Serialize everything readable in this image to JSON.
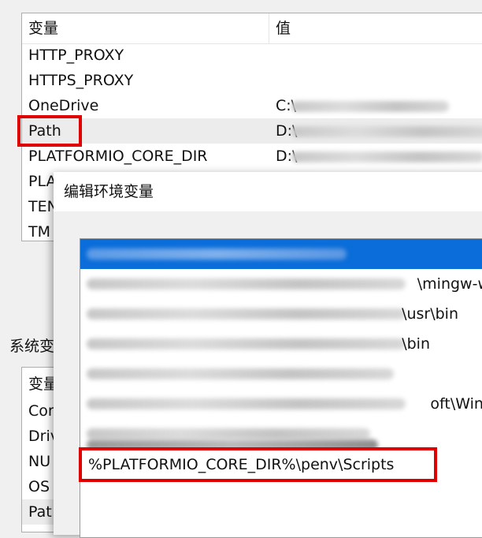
{
  "user_vars": {
    "header": {
      "name": "变量",
      "value": "值"
    },
    "rows": [
      {
        "name": "HTTP_PROXY",
        "value": ""
      },
      {
        "name": "HTTPS_PROXY",
        "value": ""
      },
      {
        "name": "OneDrive",
        "value": "C:\\"
      },
      {
        "name": "Path",
        "value": "D:\\"
      },
      {
        "name": "PLATFORMIO_CORE_DIR",
        "value": "D:\\"
      },
      {
        "name": "PLA",
        "value": ""
      },
      {
        "name": "TEN",
        "value": ""
      },
      {
        "name": "TM",
        "value": ""
      }
    ]
  },
  "system_vars": {
    "label": "系统变",
    "header": {
      "name": "变量"
    },
    "rows": [
      {
        "name": "Cor"
      },
      {
        "name": "Driv"
      },
      {
        "name": "NU"
      },
      {
        "name": "OS"
      },
      {
        "name": "Pat"
      }
    ]
  },
  "dialog": {
    "title": "编辑环境变量",
    "entries": [
      {
        "tail": ""
      },
      {
        "tail": "\\mingw-w"
      },
      {
        "tail": "\\usr\\bin"
      },
      {
        "tail": "\\bin"
      },
      {
        "tail": ""
      },
      {
        "tail": "oft\\Wind"
      },
      {
        "tail": ""
      }
    ],
    "edit_value": "%PLATFORMIO_CORE_DIR%\\penv\\Scripts"
  }
}
